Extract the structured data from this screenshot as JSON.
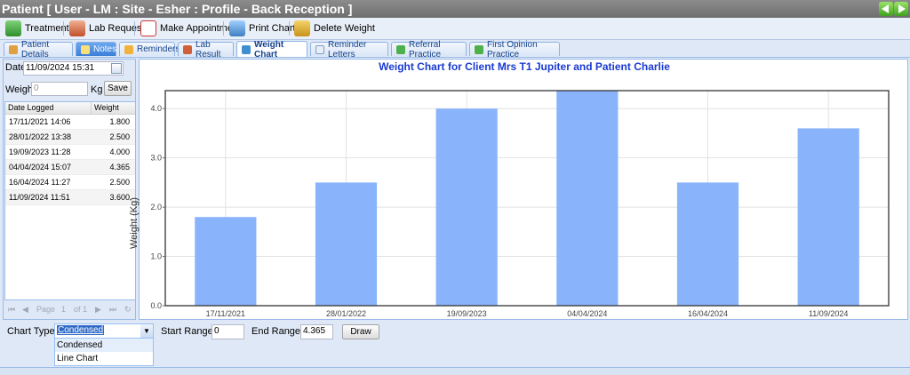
{
  "window": {
    "title": "Patient [ User - LM : Site - Esher : Profile - Back Reception ]"
  },
  "toolbar": {
    "items": [
      {
        "label": "Treatment",
        "icon": "treatment-icon"
      },
      {
        "label": "Lab Request",
        "icon": "lab-request-icon"
      },
      {
        "label": "Make Appointment",
        "icon": "calendar-icon"
      },
      {
        "label": "Print Chart",
        "icon": "print-chart-icon"
      },
      {
        "label": "Delete Weight",
        "icon": "delete-weight-icon"
      }
    ]
  },
  "tabs": [
    {
      "label": "Patient Details"
    },
    {
      "label": "Notes"
    },
    {
      "label": "Reminders"
    },
    {
      "label": "Lab Result"
    },
    {
      "label": "Weight Chart"
    },
    {
      "label": "Reminder Letters"
    },
    {
      "label": "Referral Practice"
    },
    {
      "label": "First Opinion Practice"
    }
  ],
  "weight_form": {
    "date_label": "Date",
    "date_value": "11/09/2024 15:31",
    "weight_label": "Weight",
    "weight_placeholder": "0",
    "unit_label": "Kg",
    "save_label": "Save"
  },
  "weight_grid": {
    "columns": [
      "Date Logged",
      "Weight"
    ],
    "rows": [
      [
        "17/11/2021 14:06",
        "1.800"
      ],
      [
        "28/01/2022 13:38",
        "2.500"
      ],
      [
        "19/09/2023 11:28",
        "4.000"
      ],
      [
        "04/04/2024 15:07",
        "4.365"
      ],
      [
        "16/04/2024 11:27",
        "2.500"
      ],
      [
        "11/09/2024 11:51",
        "3.600"
      ]
    ]
  },
  "pager": {
    "page_label": "Page",
    "page_value": "1",
    "of_label": "of 1"
  },
  "chart_data": {
    "type": "bar",
    "title": "Weight Chart for Client Mrs T1 Jupiter and Patient Charlie",
    "ylabel": "Weight (Kg)",
    "xlabel": "",
    "categories": [
      "17/11/2021",
      "28/01/2022",
      "19/09/2023",
      "04/04/2024",
      "16/04/2024",
      "11/09/2024"
    ],
    "values": [
      1.8,
      2.5,
      4.0,
      4.365,
      2.5,
      3.6
    ],
    "ylim": [
      0,
      4.365
    ],
    "yticks": [
      0,
      1,
      2,
      3,
      4
    ],
    "ytick_labels": [
      "0.0",
      "1.0",
      "2.0",
      "3.0",
      "4.0"
    ],
    "bar_color": "#89b3fb",
    "grid": true
  },
  "controls": {
    "chart_type_label": "Chart Type",
    "chart_type_value": "Condensed",
    "chart_type_options": [
      "Condensed",
      "Line Chart"
    ],
    "start_range_label": "Start Range",
    "start_range_value": "0",
    "end_range_label": "End Range",
    "end_range_value": "4.365",
    "draw_label": "Draw"
  }
}
